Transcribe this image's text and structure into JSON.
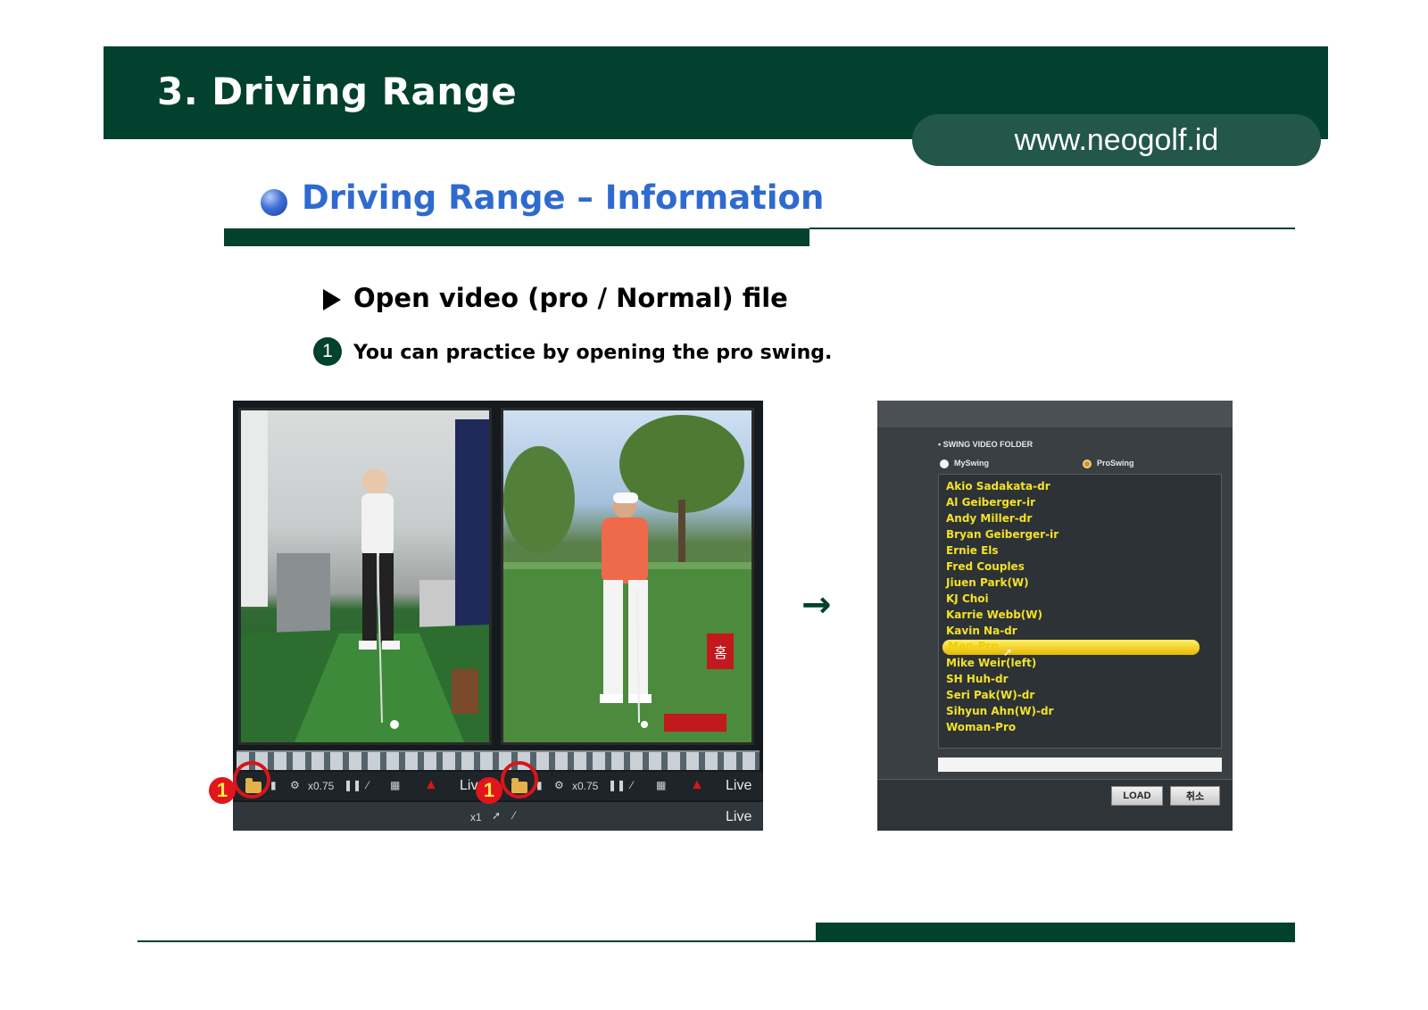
{
  "header": {
    "title": "3. Driving Range",
    "url": "www.neogolf.id"
  },
  "section": {
    "title": "Driving Range – Information"
  },
  "subsection": {
    "title": "Open video (pro / Normal) file",
    "step_number": "1",
    "description": "You can practice by opening the pro swing."
  },
  "video_panel": {
    "left_toolbar": {
      "speed": "x0.75",
      "live": "Live"
    },
    "right_toolbar": {
      "speed": "x0.75",
      "live": "Live"
    },
    "bottom_bar": {
      "zoom": "x1",
      "live": "Live"
    },
    "badge_left": "1",
    "badge_right": "1",
    "red_sign_text": "홈"
  },
  "arrow": "→",
  "dialog": {
    "heading": "• SWING VIDEO FOLDER",
    "radio_myswing": "MySwing",
    "radio_proswing": "ProSwing",
    "items": [
      "Akio Sadakata-dr",
      "Al Geiberger-ir",
      "Andy Miller-dr",
      "Bryan Geiberger-ir",
      "Ernie Els",
      "Fred Couples",
      "Jiuen Park(W)",
      "KJ Choi",
      "Karrie Webb(W)",
      "Kavin Na-dr",
      "Man-Pro",
      "Mike Weir(left)",
      "SH Huh-dr",
      "Seri Pak(W)-dr",
      "Sihyun Ahn(W)-dr",
      "Woman-Pro"
    ],
    "selected_index": 10,
    "load_label": "LOAD",
    "cancel_label": "취소"
  },
  "colors": {
    "brand_green": "#01412d",
    "accent_blue": "#2f6ad0",
    "list_yellow": "#f3e227",
    "badge_red": "#e0161c"
  }
}
